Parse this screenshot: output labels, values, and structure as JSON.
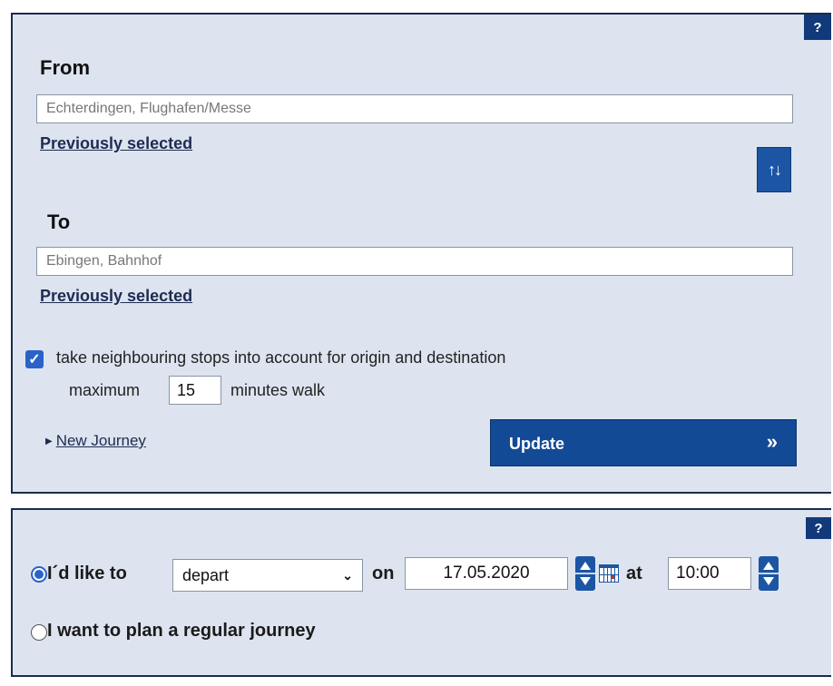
{
  "route_panel": {
    "help_label": "?",
    "from_heading": "From",
    "from_value": "Echterdingen, Flughafen/Messe",
    "from_previously_selected": "Previously selected",
    "to_heading": "To",
    "to_value": "Ebingen, Bahnhof",
    "to_previously_selected": "Previously selected",
    "swap_icon": "swap-arrows-icon",
    "swap_glyph": "↑↓",
    "neighbouring_checked": true,
    "neighbouring_label": "take neighbouring stops into account for origin and destination",
    "maximum_label": "maximum",
    "walk_minutes": "15",
    "minutes_walk_label": "minutes walk",
    "new_journey_label": "New Journey",
    "update_label": "Update",
    "update_glyph": "»"
  },
  "time_panel": {
    "help_label": "?",
    "like_to_label": "I´d like to",
    "mode_selected": "depart",
    "on_label": "on",
    "date_value": "17.05.2020",
    "at_label": "at",
    "time_value": "10:00",
    "regular_label": "I want to plan a regular journey",
    "selected_option": "like_to"
  },
  "colors": {
    "panel_bg": "#dde4ef",
    "accent": "#134a96",
    "border": "#1a2b4f"
  }
}
